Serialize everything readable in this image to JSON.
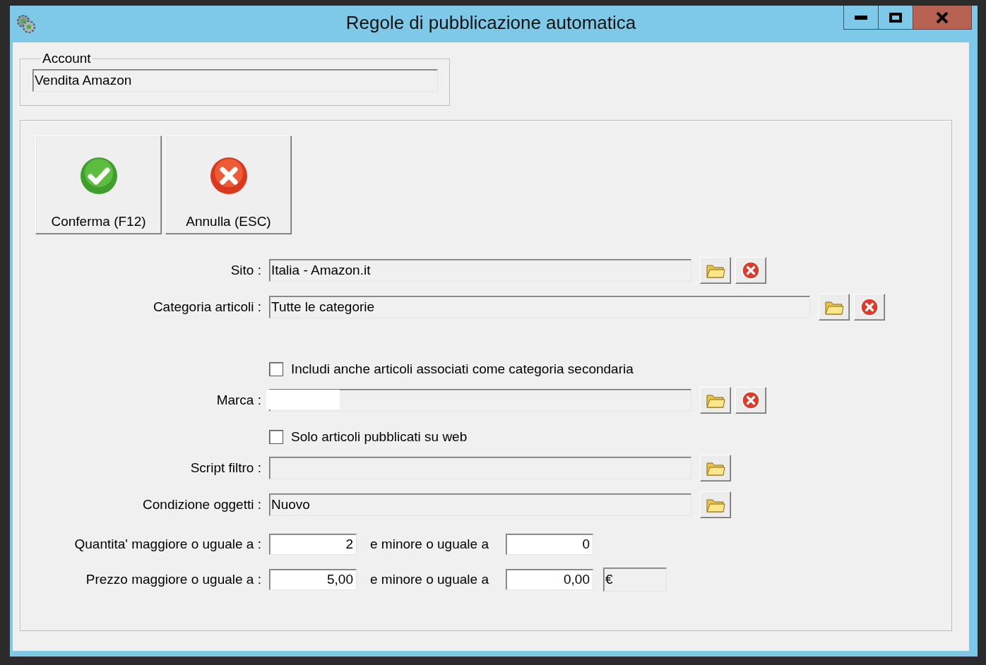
{
  "window": {
    "title": "Regole di pubblicazione automatica"
  },
  "account": {
    "legend": "Account",
    "value": "Vendita Amazon"
  },
  "actions": [
    {
      "kind": "confirm",
      "label": "Conferma (F12)"
    },
    {
      "kind": "cancel",
      "label": "Annulla (ESC)"
    }
  ],
  "form": {
    "rows": [
      {
        "kind": "lookup",
        "label": "Sito :",
        "value": "Italia - Amazon.it",
        "wide": false,
        "tools": [
          {
            "kind": "browse"
          },
          {
            "kind": "clear"
          }
        ]
      },
      {
        "kind": "lookup",
        "label": "Categoria articoli :",
        "value": "Tutte le categorie",
        "wide": true,
        "tools": [
          {
            "kind": "browse"
          },
          {
            "kind": "clear"
          }
        ]
      },
      {
        "kind": "checkbox",
        "label": "Includi anche articoli associati come categoria secondaria",
        "checked": false
      },
      {
        "kind": "lookup",
        "label": "Marca :",
        "value": "",
        "redacted": true,
        "wide": false,
        "tools": [
          {
            "kind": "browse"
          },
          {
            "kind": "clear"
          }
        ]
      },
      {
        "kind": "checkbox",
        "label": "Solo articoli pubblicati su web",
        "checked": false
      },
      {
        "kind": "lookup",
        "label": "Script filtro :",
        "value": "",
        "wide": false,
        "tools": [
          {
            "kind": "browse"
          }
        ]
      },
      {
        "kind": "lookup",
        "label": "Condizione oggetti :",
        "value": "Nuovo",
        "wide": false,
        "tools": [
          {
            "kind": "browse"
          }
        ]
      },
      {
        "kind": "range",
        "label": "Quantita' maggiore o uguale a :",
        "from": "2",
        "connector": "e minore o uguale a",
        "to": "0"
      },
      {
        "kind": "range",
        "label": "Prezzo maggiore o uguale a :",
        "from": "5,00",
        "connector": "e minore o uguale a",
        "to": "0,00",
        "unit": "€"
      }
    ]
  }
}
